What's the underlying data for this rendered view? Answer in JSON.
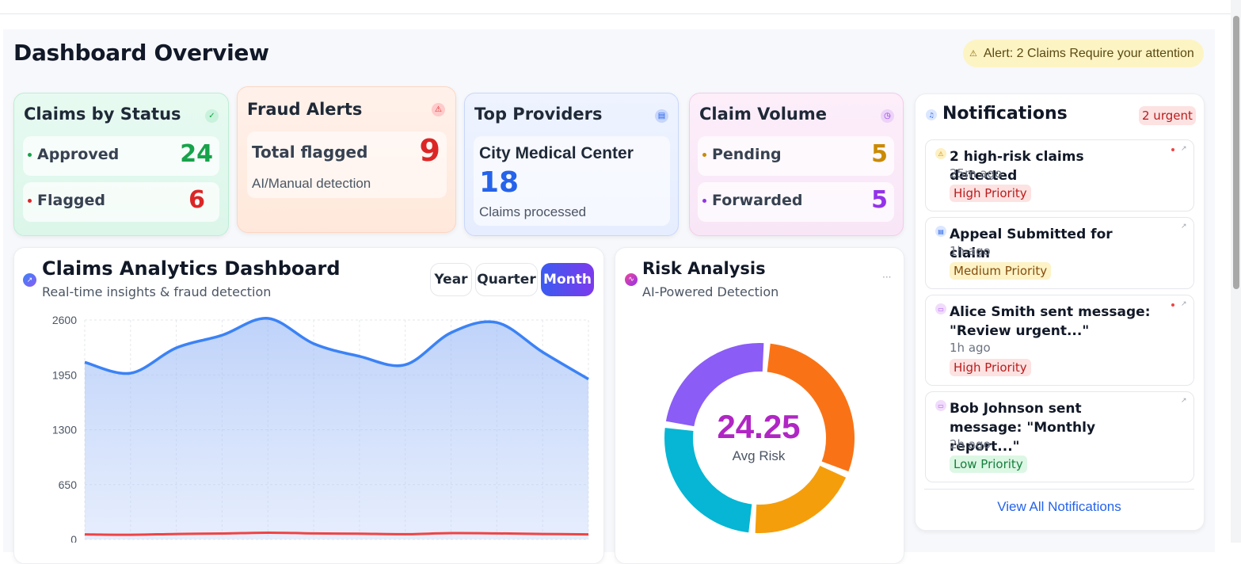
{
  "page": {
    "title": "Dashboard Overview",
    "alert": "Alert: 2 Claims Require your attention"
  },
  "status_card": {
    "title": "Claims by Status",
    "rows": [
      {
        "label": "Approved",
        "value": "24",
        "color": "#16a34a"
      },
      {
        "label": "Flagged",
        "value": "6",
        "color": "#dc2626"
      }
    ]
  },
  "fraud_card": {
    "title": "Fraud Alerts",
    "label": "Total flagged",
    "value": "9",
    "sub": "AI/Manual detection"
  },
  "providers_card": {
    "title": "Top Providers",
    "name": "City Medical Center",
    "value": "18",
    "sub": "Claims processed"
  },
  "volume_card": {
    "title": "Claim Volume",
    "rows": [
      {
        "label": "Pending",
        "value": "5",
        "color": "#ca8a04"
      },
      {
        "label": "Forwarded",
        "value": "5",
        "color": "#9333ea"
      }
    ]
  },
  "notifications": {
    "title": "Notifications",
    "badge": "2 urgent",
    "items": [
      {
        "title": "2 high-risk claims detected",
        "time": "25m ago",
        "priority": "High Priority",
        "level": "high",
        "icon": "warning-icon",
        "unread": true
      },
      {
        "title": "Appeal Submitted for claim",
        "time": "1h ago",
        "priority": "Medium Priority",
        "level": "medium",
        "icon": "document-icon",
        "unread": false
      },
      {
        "title": "Alice Smith sent message: \"Review urgent...\"",
        "time": "1h ago",
        "priority": "High Priority",
        "level": "high",
        "icon": "message-icon",
        "unread": true
      },
      {
        "title": "Bob Johnson sent message: \"Monthly report...\"",
        "time": "2h ago",
        "priority": "Low Priority",
        "level": "low",
        "icon": "message-icon",
        "unread": false
      }
    ],
    "view_all": "View All Notifications"
  },
  "analytics": {
    "title": "Claims Analytics Dashboard",
    "subtitle": "Real-time insights & fraud detection",
    "ranges": [
      "Year",
      "Quarter",
      "Month"
    ],
    "active_range": "Month"
  },
  "risk": {
    "title": "Risk Analysis",
    "subtitle": "AI-Powered Detection",
    "value": "24.25",
    "label": "Avg Risk"
  },
  "chart_data": [
    {
      "type": "area",
      "title": "Claims Analytics Dashboard",
      "yticks": [
        "2600",
        "1950",
        "1300",
        "650",
        "0"
      ],
      "ylim": [
        0,
        2600
      ],
      "grid": true,
      "series": [
        {
          "values": [
            2100,
            1970,
            2270,
            2420,
            2620,
            2320,
            2170,
            2070,
            2450,
            2570,
            2220,
            1900
          ],
          "color": "#3b82f6"
        },
        {
          "values": [
            60,
            55,
            65,
            70,
            80,
            72,
            68,
            62,
            75,
            72,
            65,
            60
          ],
          "color": "#ef4444"
        }
      ]
    },
    {
      "type": "pie",
      "title": "Risk Analysis",
      "slices": [
        {
          "value": 30,
          "color": "#f97316"
        },
        {
          "value": 20,
          "color": "#f59e0b"
        },
        {
          "value": 26,
          "color": "#06b6d4"
        },
        {
          "value": 24,
          "color": "#8b5cf6"
        }
      ]
    }
  ]
}
